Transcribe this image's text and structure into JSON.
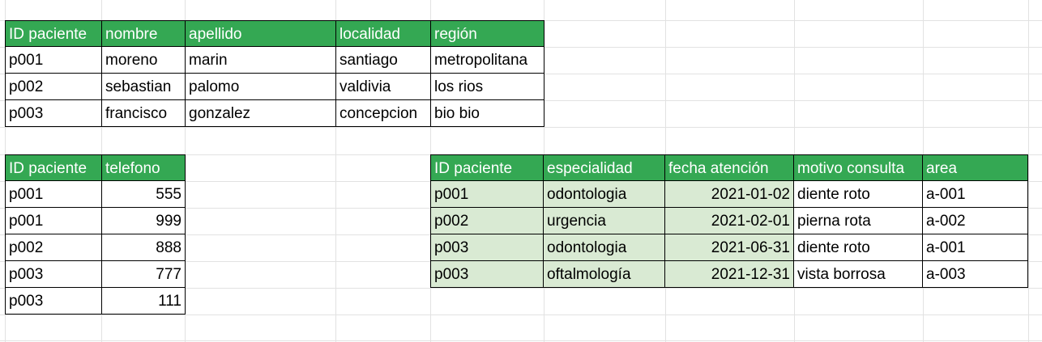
{
  "table_pacientes": {
    "headers": [
      "ID paciente",
      "nombre",
      "apellido",
      "localidad",
      "región"
    ],
    "rows": [
      [
        "p001",
        "moreno",
        "marin",
        "santiago",
        "metropolitana"
      ],
      [
        "p002",
        "sebastian",
        "palomo",
        "valdivia",
        "los rios"
      ],
      [
        "p003",
        "francisco",
        "gonzalez",
        "concepcion",
        "bio bio"
      ]
    ]
  },
  "table_telefonos": {
    "headers": [
      "ID paciente",
      "telefono"
    ],
    "rows": [
      [
        "p001",
        "555"
      ],
      [
        "p001",
        "999"
      ],
      [
        "p002",
        "888"
      ],
      [
        "p003",
        "777"
      ],
      [
        "p003",
        "111"
      ]
    ]
  },
  "table_atenciones": {
    "headers": [
      "ID paciente",
      "especialidad",
      "fecha atención",
      "motivo consulta",
      "area"
    ],
    "rows": [
      [
        "p001",
        "odontologia",
        "2021-01-02",
        "diente roto",
        "a-001"
      ],
      [
        "p002",
        "urgencia",
        "2021-02-01",
        "pierna rota",
        "a-002"
      ],
      [
        "p003",
        "odontologia",
        "2021-06-31",
        "diente roto",
        "a-001"
      ],
      [
        "p003",
        "oftalmología",
        "2021-12-31",
        "vista borrosa",
        "a-003"
      ]
    ]
  },
  "colors": {
    "header_green": "#34a853",
    "cell_light_green": "#d9ead3",
    "gridline": "#e2e2e2"
  }
}
